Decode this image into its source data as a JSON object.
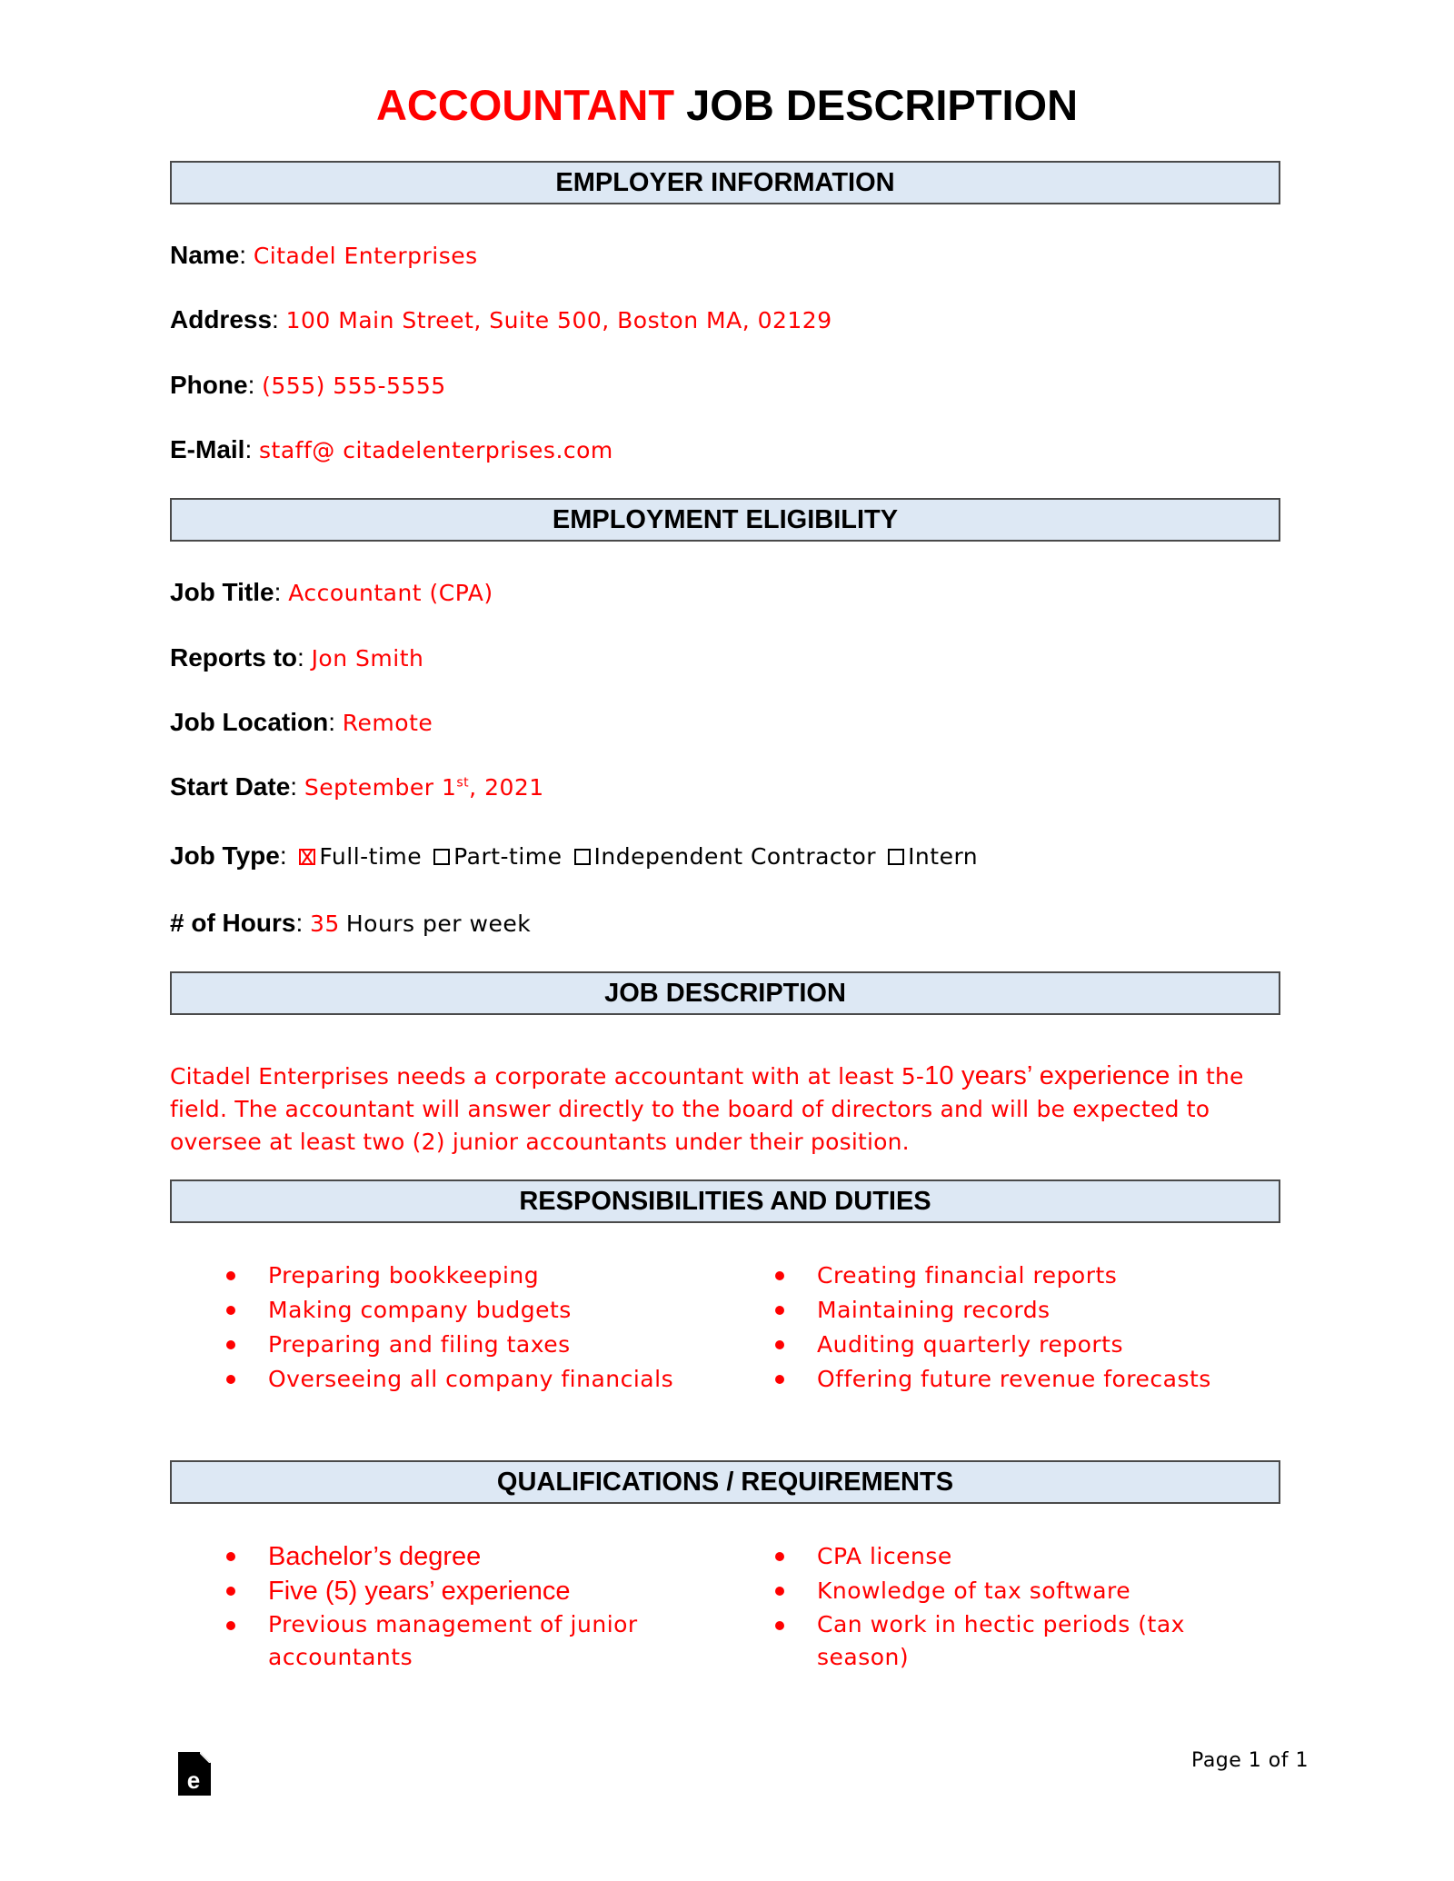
{
  "title": {
    "accent": "ACCOUNTANT",
    "rest": "JOB DESCRIPTION"
  },
  "sections": {
    "employer_information": "EMPLOYER INFORMATION",
    "employment_eligibility": "EMPLOYMENT ELIGIBILITY",
    "job_description": "JOB DESCRIPTION",
    "responsibilities": "RESPONSIBILITIES AND DUTIES",
    "qualifications": "QUALIFICATIONS / REQUIREMENTS"
  },
  "employer": {
    "name": {
      "label": "Name",
      "value": "Citadel Enterprises"
    },
    "address": {
      "label": "Address",
      "value": "100 Main Street, Suite 500, Boston MA, 02129"
    },
    "phone": {
      "label": "Phone",
      "value": "(555) 555-5555"
    },
    "email": {
      "label": "E-Mail",
      "value": "staff@ citadelenterprises.com"
    }
  },
  "eligibility": {
    "job_title": {
      "label": "Job Title",
      "value": "Accountant (CPA)"
    },
    "reports_to": {
      "label": "Reports to",
      "value": "Jon Smith"
    },
    "job_location": {
      "label": "Job Location",
      "value": "Remote"
    },
    "start_date": {
      "label": "Start Date",
      "value_month_day": "September 1",
      "value_suffix": "st",
      "value_year": ", 2021"
    },
    "job_type": {
      "label": "Job Type",
      "options": [
        {
          "label": "Full-time",
          "checked": true
        },
        {
          "label": "Part-time",
          "checked": false
        },
        {
          "label": "Independent Contractor",
          "checked": false
        },
        {
          "label": "Intern",
          "checked": false
        }
      ]
    },
    "hours": {
      "label": "# of Hours",
      "value": "35",
      "suffix": "Hours per week"
    }
  },
  "description": {
    "part1": "Citadel Enterprises needs a corporate accountant with at least 5-",
    "part2": "10 years’ experience in",
    "part3": "the field. The accountant will answer directly to the board of directors and will be expected to oversee at least two (2) junior accountants under their position."
  },
  "responsibilities": {
    "left": [
      "Preparing bookkeeping",
      "Making company budgets",
      "Preparing and filing taxes",
      "Overseeing all company financials"
    ],
    "right": [
      "Creating financial reports",
      "Maintaining records",
      "Auditing quarterly reports",
      "Offering future revenue forecasts"
    ]
  },
  "qualifications": {
    "left": [
      "Bachelor’s degree",
      "Five (5) years’ experience",
      "Previous management of junior accountants"
    ],
    "right": [
      "CPA license",
      "Knowledge of tax software",
      "Can work in hectic periods (tax season)"
    ]
  },
  "footer": {
    "logo_icon": "eforms-logo-icon",
    "page": "Page 1 of 1"
  },
  "colors": {
    "accent": "#ff0000",
    "header_bg": "#dde8f4",
    "header_border": "#4a4a4a"
  }
}
